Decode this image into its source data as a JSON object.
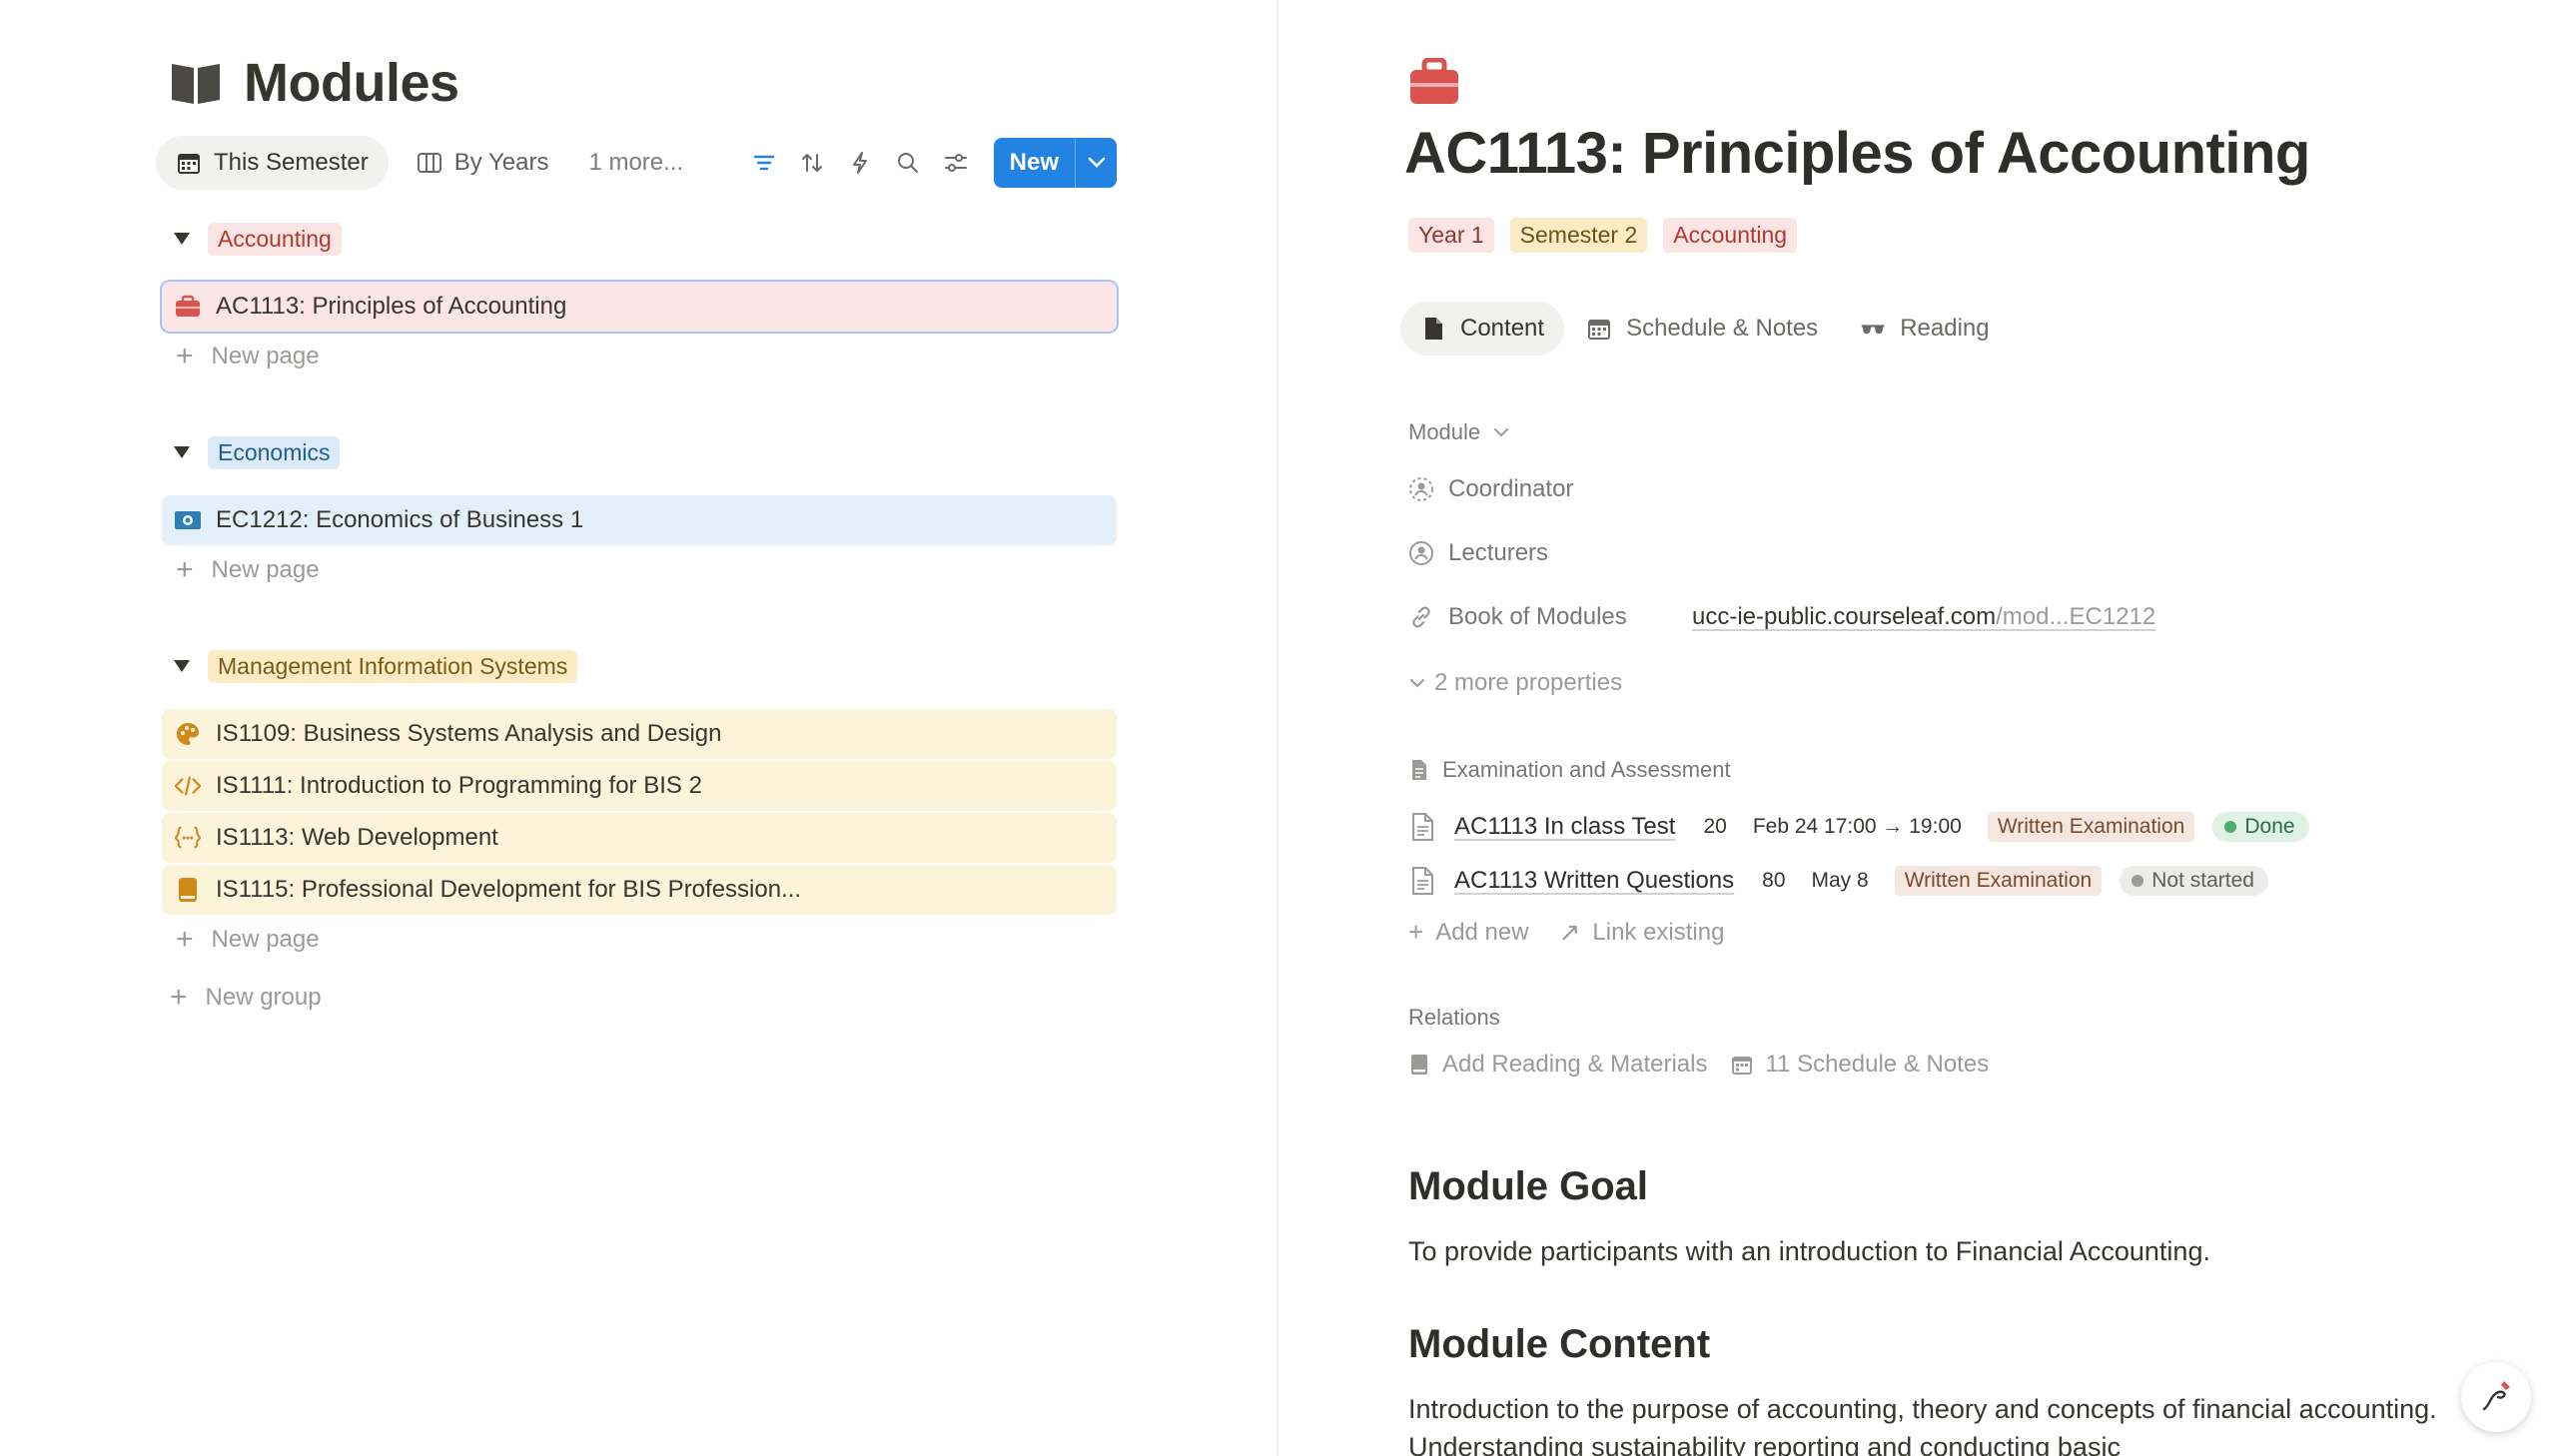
{
  "database": {
    "title": "Modules",
    "icon": "open-book-icon"
  },
  "views": {
    "tabs": [
      {
        "label": "This Semester",
        "icon": "calendar-icon",
        "active": true
      },
      {
        "label": "By Years",
        "icon": "board-icon",
        "active": false
      }
    ],
    "more_label": "1 more...",
    "tools": [
      "filter-icon",
      "sort-icon",
      "lightning-icon",
      "search-icon",
      "settings-sliders-icon"
    ],
    "new_button_label": "New"
  },
  "groups": [
    {
      "name": "Accounting",
      "color": "#fbe4e4",
      "items": [
        {
          "title": "AC1113: Principles of Accounting",
          "icon": "briefcase-icon"
        }
      ],
      "new_page_label": "New page"
    },
    {
      "name": "Economics",
      "color": "#dbeaf6",
      "items": [
        {
          "title": "EC1212: Economics of Business 1",
          "icon": "money-icon"
        }
      ],
      "new_page_label": "New page"
    },
    {
      "name": "Management Information Systems",
      "color": "#fbecc6",
      "items": [
        {
          "title": "IS1109: Business Systems Analysis and Design",
          "icon": "palette-icon"
        },
        {
          "title": "IS1111: Introduction to Programming for BIS 2",
          "icon": "code-icon"
        },
        {
          "title": "IS1113: Web Development",
          "icon": "braces-icon"
        },
        {
          "title": "IS1115: Professional Development for BIS Profession...",
          "icon": "book-icon"
        }
      ],
      "new_page_label": "New page"
    }
  ],
  "new_group_label": "New group",
  "page": {
    "icon": "briefcase-icon",
    "title": "AC1113: Principles of Accounting",
    "tags": [
      "Year 1",
      "Semester 2",
      "Accounting"
    ],
    "tabs": [
      {
        "label": "Content",
        "icon": "document-icon",
        "active": true
      },
      {
        "label": "Schedule & Notes",
        "icon": "calendar-icon",
        "active": false
      },
      {
        "label": "Reading",
        "icon": "glasses-icon",
        "active": false
      }
    ],
    "properties_section": "Module",
    "properties": [
      {
        "label": "Coordinator",
        "icon": "person-dashed-icon",
        "value": ""
      },
      {
        "label": "Lecturers",
        "icon": "person-circle-icon",
        "value": ""
      },
      {
        "label": "Book of Modules",
        "icon": "link-icon",
        "value_main": "ucc-ie-public.courseleaf.com",
        "value_dim": "/mod...EC1212"
      }
    ],
    "more_properties_label": "2 more properties",
    "exam_section": "Examination and Assessment",
    "exams": [
      {
        "name": "AC1113 In class Test",
        "weight": "20",
        "date": "Feb 24 17:00 → 19:00",
        "type": "Written Examination",
        "status": "Done"
      },
      {
        "name": "AC1113 Written Questions",
        "weight": "80",
        "date": "May 8",
        "type": "Written Examination",
        "status": "Not started"
      }
    ],
    "add_new_label": "Add new",
    "link_existing_label": "Link existing",
    "relations_label": "Relations",
    "relations": [
      {
        "label": "Add Reading & Materials",
        "icon": "book-icon"
      },
      {
        "label": "11 Schedule & Notes",
        "icon": "calendar-icon"
      }
    ],
    "sections": [
      {
        "heading": "Module Goal",
        "body": "To provide participants with an introduction to Financial Accounting."
      },
      {
        "heading": "Module Content",
        "body": "Introduction to the purpose of accounting, theory and concepts of financial accounting. Understanding sustainability reporting and conducting basic"
      }
    ]
  },
  "colors": {
    "accent": "#2383e2",
    "selected_outline": "#a7c4ee"
  }
}
